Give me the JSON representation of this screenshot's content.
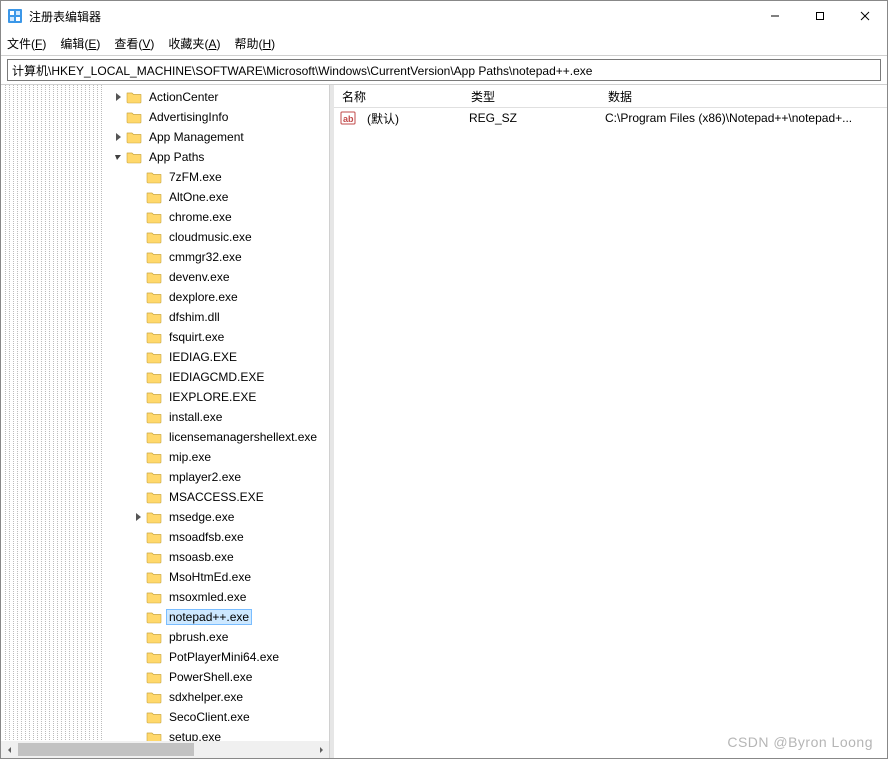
{
  "window": {
    "title": "注册表编辑器",
    "controls": {
      "minimize": "—",
      "maximize": "▢",
      "close": "✕"
    }
  },
  "menu": {
    "file": {
      "label": "文件",
      "key": "F"
    },
    "edit": {
      "label": "编辑",
      "key": "E"
    },
    "view": {
      "label": "查看",
      "key": "V"
    },
    "fav": {
      "label": "收藏夹",
      "key": "A"
    },
    "help": {
      "label": "帮助",
      "key": "H"
    }
  },
  "address": "计算机\\HKEY_LOCAL_MACHINE\\SOFTWARE\\Microsoft\\Windows\\CurrentVersion\\App Paths\\notepad++.exe",
  "tree": {
    "top_level": [
      {
        "label": "ActionCenter",
        "expander": "closed"
      },
      {
        "label": "AdvertisingInfo",
        "expander": "none"
      },
      {
        "label": "App Management",
        "expander": "closed"
      },
      {
        "label": "App Paths",
        "expander": "open"
      }
    ],
    "app_paths_children": [
      "7zFM.exe",
      "AltOne.exe",
      "chrome.exe",
      "cloudmusic.exe",
      "cmmgr32.exe",
      "devenv.exe",
      "dexplore.exe",
      "dfshim.dll",
      "fsquirt.exe",
      "IEDIAG.EXE",
      "IEDIAGCMD.EXE",
      "IEXPLORE.EXE",
      "install.exe",
      "licensemanagershellext.exe",
      "mip.exe",
      "mplayer2.exe",
      "MSACCESS.EXE",
      "msedge.exe",
      "msoadfsb.exe",
      "msoasb.exe",
      "MsoHtmEd.exe",
      "msoxmled.exe",
      "notepad++.exe",
      "pbrush.exe",
      "PotPlayerMini64.exe",
      "PowerShell.exe",
      "sdxhelper.exe",
      "SecoClient.exe",
      "setup.exe"
    ],
    "child_with_expander": "msedge.exe",
    "selected": "notepad++.exe"
  },
  "list": {
    "columns": {
      "name": "名称",
      "type": "类型",
      "data": "数据"
    },
    "rows": [
      {
        "name": "(默认)",
        "type": "REG_SZ",
        "data": "C:\\Program Files (x86)\\Notepad++\\notepad+..."
      }
    ]
  },
  "watermark": "CSDN @Byron Loong"
}
